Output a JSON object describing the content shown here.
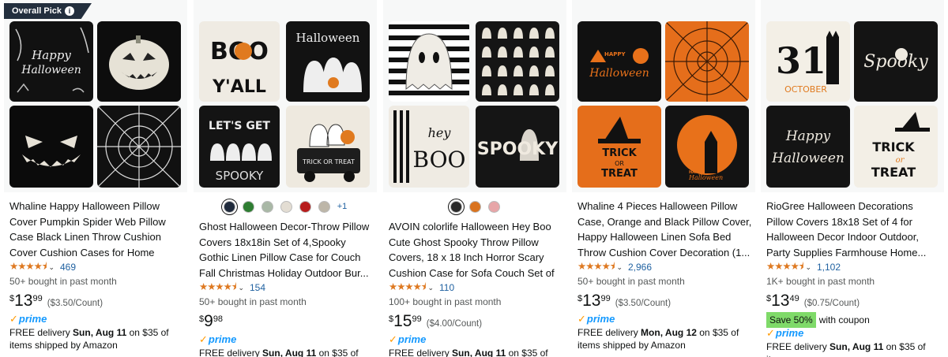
{
  "badge": {
    "label": "Overall Pick",
    "icon": "info-icon"
  },
  "products": [
    {
      "title": "Whaline Happy Halloween Pillow Cover Pumpkin Spider Web Pillow Case Black Linen Throw Cushion Cover Cushion Cases for Home Offic...",
      "rating": 4.5,
      "rating_count": "469",
      "bought": "50+ bought in past month",
      "price": {
        "currency": "$",
        "whole": "13",
        "fraction": "99",
        "unit": "($3.50/Count)"
      },
      "prime": "prime",
      "delivery": {
        "prefix": "FREE delivery ",
        "date": "Sun, Aug 11",
        "suffix": " on $35 of items shipped by Amazon"
      },
      "images": [
        "happy-halloween-pillow",
        "pumpkin-face-pillow",
        "jack-o-lantern-face-pillow",
        "spider-web-pillow"
      ]
    },
    {
      "title": "Ghost Halloween Decor-Throw Pillow Covers 18x18in Set of 4,Spooky Gothic Linen Pillow Case for Couch Fall Christmas Holiday Outdoor Bur...",
      "rating": 4.5,
      "rating_count": "154",
      "bought": "50+ bought in past month",
      "price": {
        "currency": "$",
        "whole": "9",
        "fraction": "98"
      },
      "prime": "prime",
      "delivery": {
        "prefix": "FREE delivery ",
        "date": "Sun, Aug 11",
        "suffix": " on $35 of items"
      },
      "swatches": [
        "#1F2A3C",
        "#2E7D32",
        "#A9B8A6",
        "#E3DDD3",
        "#B71C1C",
        "#BDB6A8"
      ],
      "swatch_more": "+1",
      "images": [
        "boo-yall-pillow",
        "halloween-ghosts-pillow",
        "lets-get-spooky-pillow",
        "trick-or-treat-truck-pillow"
      ]
    },
    {
      "title": "AVOIN colorlife Halloween Hey Boo Cute Ghost Spooky Throw Pillow Covers, 18 x 18 Inch Horror Scary Cushion Case for Sofa Couch Set of ...",
      "rating": 4.5,
      "rating_count": "110",
      "bought": "100+ bought in past month",
      "price": {
        "currency": "$",
        "whole": "15",
        "fraction": "99",
        "unit": "($4.00/Count)"
      },
      "prime": "prime",
      "delivery": {
        "prefix": "FREE delivery ",
        "date": "Sun, Aug 11",
        "suffix": " on $35 of items"
      },
      "swatches": [
        "#2A2A2A",
        "#D9731F",
        "#E7A6A8"
      ],
      "images": [
        "striped-ghost-pillow",
        "ghost-pattern-pillow",
        "hey-boo-pillow",
        "spooky-pillow"
      ]
    },
    {
      "title": "Whaline 4 Pieces Halloween Pillow Case, Orange and Black Pillow Cover, Happy Halloween Linen Sofa Bed Throw Cushion Cover Decoration (1...",
      "rating": 4.5,
      "rating_count": "2,966",
      "bought": "50+ bought in past month",
      "price": {
        "currency": "$",
        "whole": "13",
        "fraction": "99",
        "unit": "($3.50/Count)"
      },
      "prime": "prime",
      "delivery": {
        "prefix": "FREE delivery ",
        "date": "Mon, Aug 12",
        "suffix": " on $35 of items shipped by Amazon"
      },
      "images": [
        "happy-halloween-orange-pillow",
        "orange-spiderweb-pillow",
        "trick-or-treat-hat-pillow",
        "haunted-house-pillow"
      ]
    },
    {
      "title": "RioGree Halloween Decorations Pillow Covers 18x18 Set of 4 for Halloween Decor Indoor Outdoor, Party Supplies Farmhouse Home...",
      "rating": 4.5,
      "rating_count": "1,102",
      "bought": "1K+ bought in past month",
      "price": {
        "currency": "$",
        "whole": "13",
        "fraction": "49",
        "unit": "($0.75/Count)"
      },
      "save": "Save 50%",
      "coupon": "with coupon",
      "prime": "prime",
      "delivery": {
        "prefix": "FREE delivery ",
        "date": "Sun, Aug 11",
        "suffix": " on $35 of items"
      },
      "images": [
        "31-october-pillow",
        "spooky-skull-pillow",
        "happy-halloween-script-pillow",
        "trick-or-treat-witch-pillow"
      ]
    }
  ],
  "pillow_text": {
    "p0": [
      "Happy",
      "Halloween"
    ],
    "p1a": [
      "BOO",
      "Y'ALL"
    ],
    "p1b": [
      "Halloween"
    ],
    "p1c": [
      "LET'S GET",
      "SPOOKY"
    ],
    "p1d": [
      "TRICK OR TREAT"
    ],
    "p2c": [
      "hey",
      "BOO"
    ],
    "p2d": [
      "SPOOKY"
    ],
    "p3a": [
      "HAPPY",
      "Halloween"
    ],
    "p3c": [
      "TRICK",
      "OR",
      "TREAT"
    ],
    "p3d": [
      "HAPPY",
      "Halloween"
    ],
    "p4a": [
      "31",
      "OCTOBER"
    ],
    "p4b": [
      "Spooky"
    ],
    "p4c": [
      "Happy",
      "Halloween"
    ],
    "p4d": [
      "TRICK",
      "or",
      "TREAT"
    ]
  },
  "colors": {
    "accent_orange": "#DE7921",
    "link_blue": "#2162A1",
    "prime_blue": "#1399FF",
    "badge_bg": "#232F3E",
    "save_green": "#7FDA69"
  }
}
